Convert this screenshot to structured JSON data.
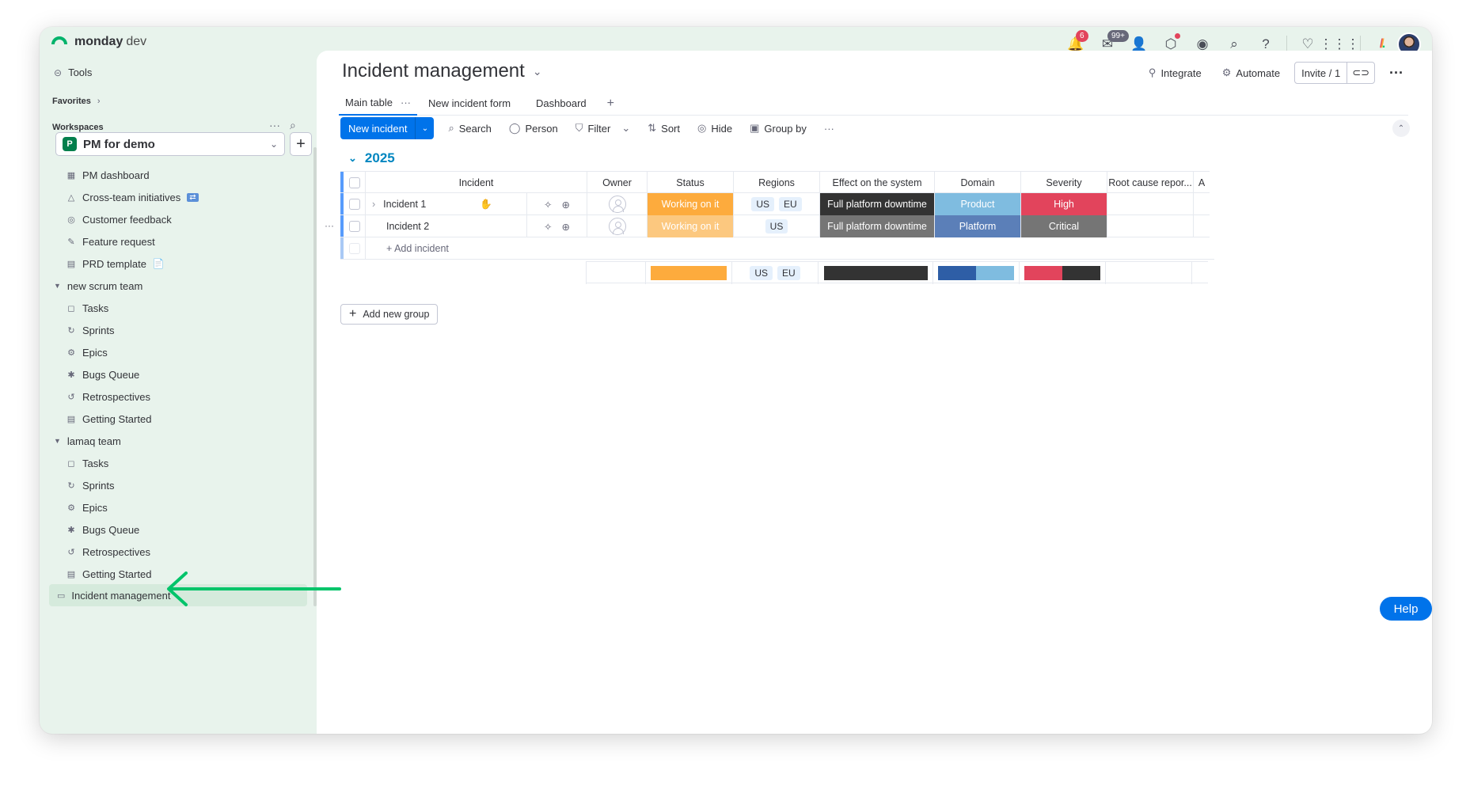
{
  "app": {
    "brand": "monday",
    "brand_suffix": "dev"
  },
  "topbar": {
    "notifications_count": "6",
    "inbox_count": "99+"
  },
  "sidebar": {
    "tools": "Tools",
    "favorites": "Favorites",
    "workspaces": "Workspaces",
    "workspace_badge": "P",
    "workspace_name": "PM for demo",
    "items_top": [
      {
        "label": "PM dashboard",
        "icon": "dashboard-icon"
      },
      {
        "label": "Cross-team initiatives",
        "icon": "board-icon"
      },
      {
        "label": "Customer feedback",
        "icon": "feedback-icon"
      },
      {
        "label": "Feature request",
        "icon": "form-icon"
      },
      {
        "label": "PRD template",
        "icon": "doc-icon"
      }
    ],
    "folder1": {
      "label": "new scrum team",
      "items": [
        "Tasks",
        "Sprints",
        "Epics",
        "Bugs Queue",
        "Retrospectives",
        "Getting Started"
      ]
    },
    "folder2": {
      "label": "lamaq team",
      "items": [
        "Tasks",
        "Sprints",
        "Epics",
        "Bugs Queue",
        "Retrospectives",
        "Getting Started"
      ]
    },
    "active_item": "Incident management"
  },
  "board": {
    "title": "Incident management",
    "integrate": "Integrate",
    "automate": "Automate",
    "invite": "Invite / 1",
    "tabs": [
      "Main table",
      "New incident form",
      "Dashboard"
    ],
    "toolbar": {
      "new": "New incident",
      "search": "Search",
      "person": "Person",
      "filter": "Filter",
      "sort": "Sort",
      "hide": "Hide",
      "group_by": "Group by"
    },
    "group_title": "2025",
    "columns": [
      "Incident",
      "Owner",
      "Status",
      "Regions",
      "Effect on the system",
      "Domain",
      "Severity",
      "Root cause repor...",
      "A"
    ],
    "rows": [
      {
        "name": "Incident 1",
        "status": "Working on it",
        "regions": [
          "US",
          "EU"
        ],
        "effect": "Full platform downtime",
        "domain": "Product",
        "severity": "High"
      },
      {
        "name": "Incident 2",
        "status": "Working on it",
        "regions": [
          "US"
        ],
        "effect": "Full platform downtime",
        "domain": "Platform",
        "severity": "Critical"
      }
    ],
    "add_item": "+ Add incident",
    "summary_regions": [
      "US",
      "EU"
    ],
    "add_group": "Add new group",
    "help": "Help"
  },
  "colors": {
    "status_working": "#fdab3d",
    "status_working_light": "#fcc87f",
    "effect_dark": "#333333",
    "effect_gray": "#757575",
    "domain_product": "#7fbce0",
    "domain_platform": "#5b7fb8",
    "severity_high": "#e2445c",
    "severity_critical": "#757575",
    "accent": "#0073ea",
    "arrow": "#00c46a"
  }
}
